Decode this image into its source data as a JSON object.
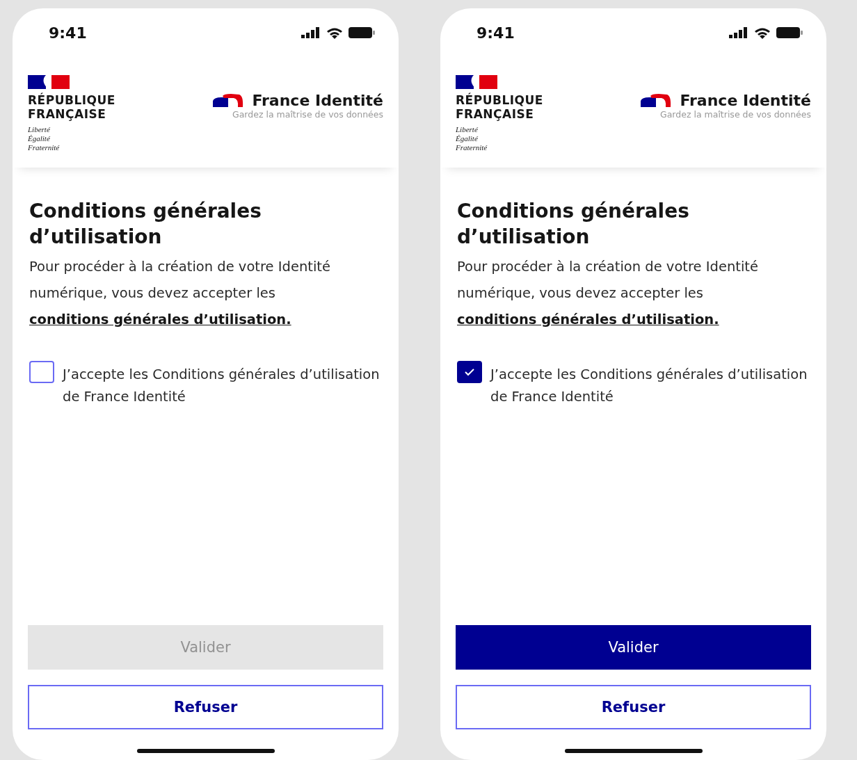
{
  "phones": [
    {
      "status_bar": {
        "time": "9:41"
      },
      "header": {
        "republic_lines": [
          "RÉPUBLIQUE",
          "FRANÇAISE"
        ],
        "motto_lines": [
          "Liberté",
          "Égalité",
          "Fraternité"
        ],
        "brand": "France Identité",
        "tagline": "Gardez la maîtrise de vos données"
      },
      "title": "Conditions générales d’utilisation",
      "intro": "Pour procéder à la création de votre Identité numérique, vous devez accepter les",
      "intro_link": "conditions générales d’utilisation.",
      "checkbox": {
        "label": "J’accepte les Conditions générales d’utilisation de France Identité",
        "checked": false
      },
      "validate_button": {
        "label": "Valider",
        "disabled": true
      },
      "refuse_button": {
        "label": "Refuser"
      }
    },
    {
      "status_bar": {
        "time": "9:41"
      },
      "header": {
        "republic_lines": [
          "RÉPUBLIQUE",
          "FRANÇAISE"
        ],
        "motto_lines": [
          "Liberté",
          "Égalité",
          "Fraternité"
        ],
        "brand": "France Identité",
        "tagline": "Gardez la maîtrise de vos données"
      },
      "title": "Conditions générales d’utilisation",
      "intro": "Pour procéder à la création de votre Identité numérique, vous devez accepter les",
      "intro_link": "conditions générales d’utilisation.",
      "checkbox": {
        "label": "J’accepte les Conditions générales d’utilisation de France Identité",
        "checked": true
      },
      "validate_button": {
        "label": "Valider",
        "disabled": false
      },
      "refuse_button": {
        "label": "Refuser"
      }
    }
  ]
}
